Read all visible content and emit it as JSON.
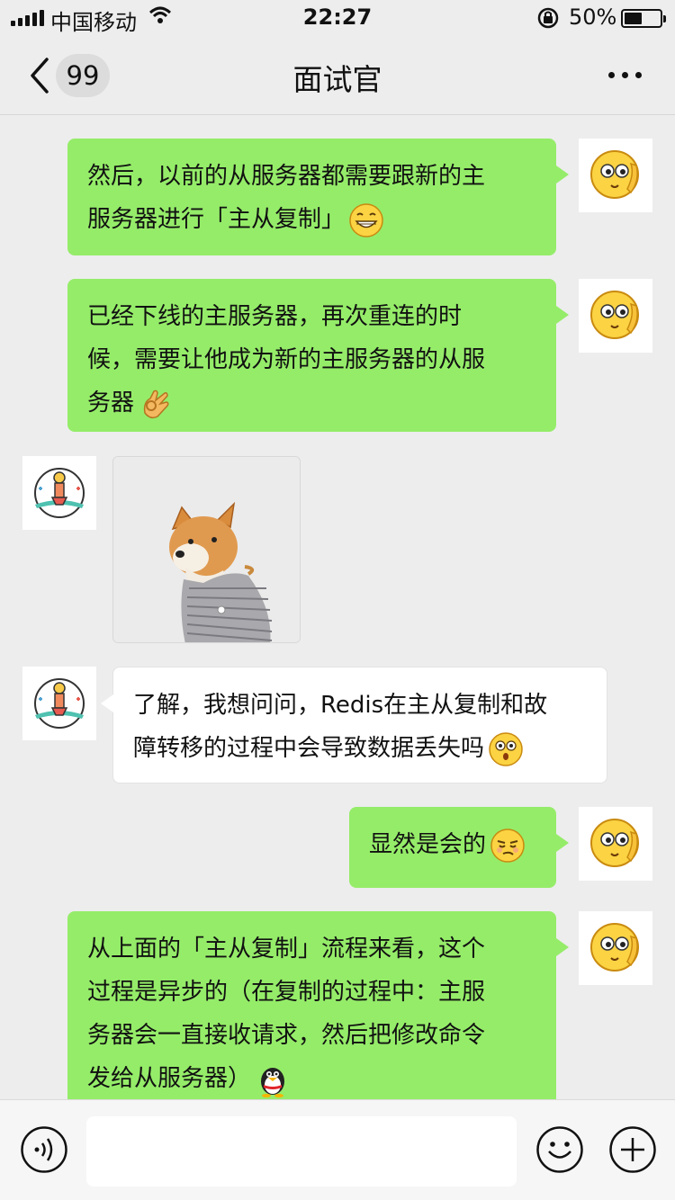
{
  "status_bar": {
    "carrier": "中国移动",
    "time": "22:27",
    "battery": "50%",
    "battery_level": 0.5
  },
  "nav": {
    "unread_count": "99",
    "title": "面试官",
    "back_icon": "chevron-left-icon",
    "more_icon": "ellipsis-icon"
  },
  "messages": [
    {
      "from": "me",
      "text_lines": [
        "然后，以前的从服务器都需要跟新的主",
        "服务器进行「主从复制」"
      ],
      "emoji": "grin-emoji"
    },
    {
      "from": "me",
      "text_lines": [
        "已经下线的主服务器，再次重连的时",
        "候，需要让他成为新的主服务器的从服",
        "务器"
      ],
      "emoji": "ok-hand-emoji"
    },
    {
      "from": "them",
      "type": "image",
      "image": "shiba-dog-photo"
    },
    {
      "from": "them",
      "text_lines": [
        "了解，我想问问，Redis在主从复制和故",
        "障转移的过程中会导致数据丢失吗"
      ],
      "emoji": "dizzy-face-emoji"
    },
    {
      "from": "me",
      "text_lines": [
        "显然是会的"
      ],
      "emoji": "smirk-emoji"
    },
    {
      "from": "me",
      "text_lines": [
        "从上面的「主从复制」流程来看，这个",
        "过程是异步的（在复制的过程中：主服",
        "务器会一直接收请求，然后把修改命令",
        "发给从服务器）"
      ],
      "emoji": "penguin-emoji"
    }
  ],
  "input_bar": {
    "voice_icon": "voice-icon",
    "input_value": "",
    "emoji_icon": "smiley-icon",
    "plus_icon": "plus-icon"
  },
  "colors": {
    "background": "#ededed",
    "my_bubble": "#95ec69",
    "their_bubble": "#ffffff"
  }
}
